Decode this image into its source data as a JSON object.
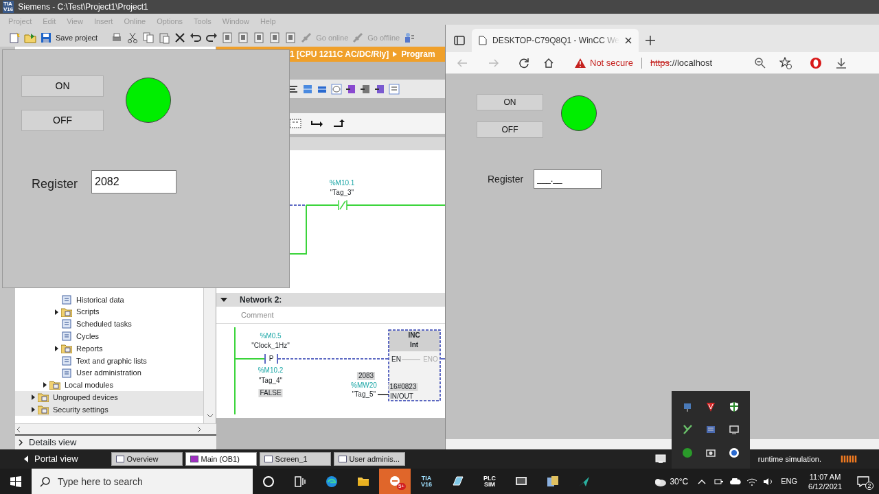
{
  "tia": {
    "logo": [
      "TIA",
      "V16"
    ],
    "title": "Siemens - C:\\Test\\Project1\\Project1",
    "menu": [
      "Project",
      "Edit",
      "View",
      "Insert",
      "Online",
      "Options",
      "Tools",
      "Window",
      "Help"
    ],
    "toolbar": {
      "save_label": "Save project",
      "online_label": "Go online",
      "offline_label": "Go offline"
    },
    "breadcrumb": [
      "1 [CPU 1211C AC/DC/Rly]",
      "Program"
    ],
    "project_tree": [
      {
        "children": [
          {
            "children": [
              {
                "label": "Historical data",
                "kind": "item"
              },
              {
                "label": "Scripts",
                "kind": "folder",
                "expanded": false
              },
              {
                "label": "Scheduled tasks",
                "kind": "item"
              },
              {
                "label": "Cycles",
                "kind": "item"
              },
              {
                "label": "Reports",
                "kind": "folder",
                "expanded": false
              },
              {
                "label": "Text and graphic lists",
                "kind": "item"
              },
              {
                "label": "User administration",
                "kind": "item"
              }
            ]
          },
          {
            "label": "Local modules",
            "kind": "folder",
            "expanded": false
          }
        ]
      },
      {
        "label": "Ungrouped devices",
        "kind": "folder",
        "expanded": false
      },
      {
        "label": "Security settings",
        "kind": "folder",
        "expanded": false
      }
    ],
    "details_view": "Details view",
    "network_1": {
      "contact": {
        "address": "%M10.1",
        "tag": "\"Tag_3\""
      }
    },
    "network_2": {
      "title": "Network 2:",
      "comment": "Comment",
      "edge_contact": {
        "address": "%M0.5",
        "tag": "\"Clock_1Hz\"",
        "symbol": "P",
        "edge_address": "%M10.2",
        "edge_tag": "\"Tag_4\"",
        "status": "FALSE"
      },
      "box": {
        "name": "INC",
        "type": "Int",
        "en": "EN",
        "eno": "ENO",
        "inout_status": "16#0823",
        "inout_label": "IN/OUT",
        "operand_value": "2083",
        "operand_address": "%MW20",
        "operand_tag": "\"Tag_5\""
      }
    },
    "status_bar": {
      "portal_view": "Portal view",
      "tabs": [
        {
          "label": "Overview",
          "selected": false
        },
        {
          "label": "Main (OB1)",
          "selected": true
        },
        {
          "label": "Screen_1",
          "selected": false
        },
        {
          "label": "User adminis...",
          "selected": false
        }
      ],
      "message": "runtime simulation."
    }
  },
  "runtime_window": {
    "buttons": [
      "ON",
      "OFF"
    ],
    "lamp_on": true,
    "label": "Register",
    "value": "2082"
  },
  "browser": {
    "tab_title": "DESKTOP-C79Q8Q1 - WinCC We",
    "security": "Not secure",
    "url_scheme": "https",
    "url_rest": "://localhost",
    "page": {
      "buttons": [
        "ON",
        "OFF"
      ],
      "lamp_on": true,
      "label": "Register",
      "value": "___.__"
    }
  },
  "taskbar": {
    "search_placeholder": "Type here to search",
    "apps": [
      {
        "kind": "cortana",
        "active": false
      },
      {
        "kind": "task_view",
        "active": false
      },
      {
        "kind": "edge",
        "active": false
      },
      {
        "kind": "explorer",
        "active": false
      },
      {
        "kind": "badge_app",
        "active": true,
        "badge": "5+"
      },
      {
        "kind": "tia",
        "active": false,
        "label": [
          "TIA",
          "V16"
        ]
      },
      {
        "kind": "book",
        "active": false
      },
      {
        "kind": "plcsim",
        "active": false,
        "label": [
          "PLC",
          "SIM"
        ]
      },
      {
        "kind": "monitor",
        "active": false
      },
      {
        "kind": "files",
        "active": false
      },
      {
        "kind": "arrow",
        "active": false
      }
    ],
    "temperature": "30°C",
    "language": "ENG",
    "time": "11:07 AM",
    "date": "6/12/2021",
    "notifications": "2"
  }
}
